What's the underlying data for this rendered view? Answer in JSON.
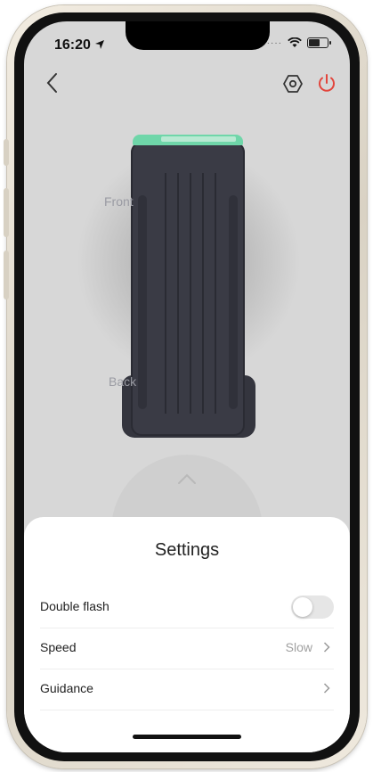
{
  "status_bar": {
    "time": "16:20"
  },
  "nav": {
    "back_icon": "chevron-left-icon",
    "settings_icon": "hexagon-settings-icon",
    "power_icon": "power-icon",
    "power_color": "#e2453c"
  },
  "device": {
    "front_label": "Front",
    "back_label": "Back",
    "light_color": "#6fd6a9"
  },
  "settings": {
    "title": "Settings",
    "rows": [
      {
        "label": "Double flash",
        "toggle_on": false
      },
      {
        "label": "Speed",
        "value": "Slow"
      },
      {
        "label": "Guidance"
      }
    ]
  }
}
